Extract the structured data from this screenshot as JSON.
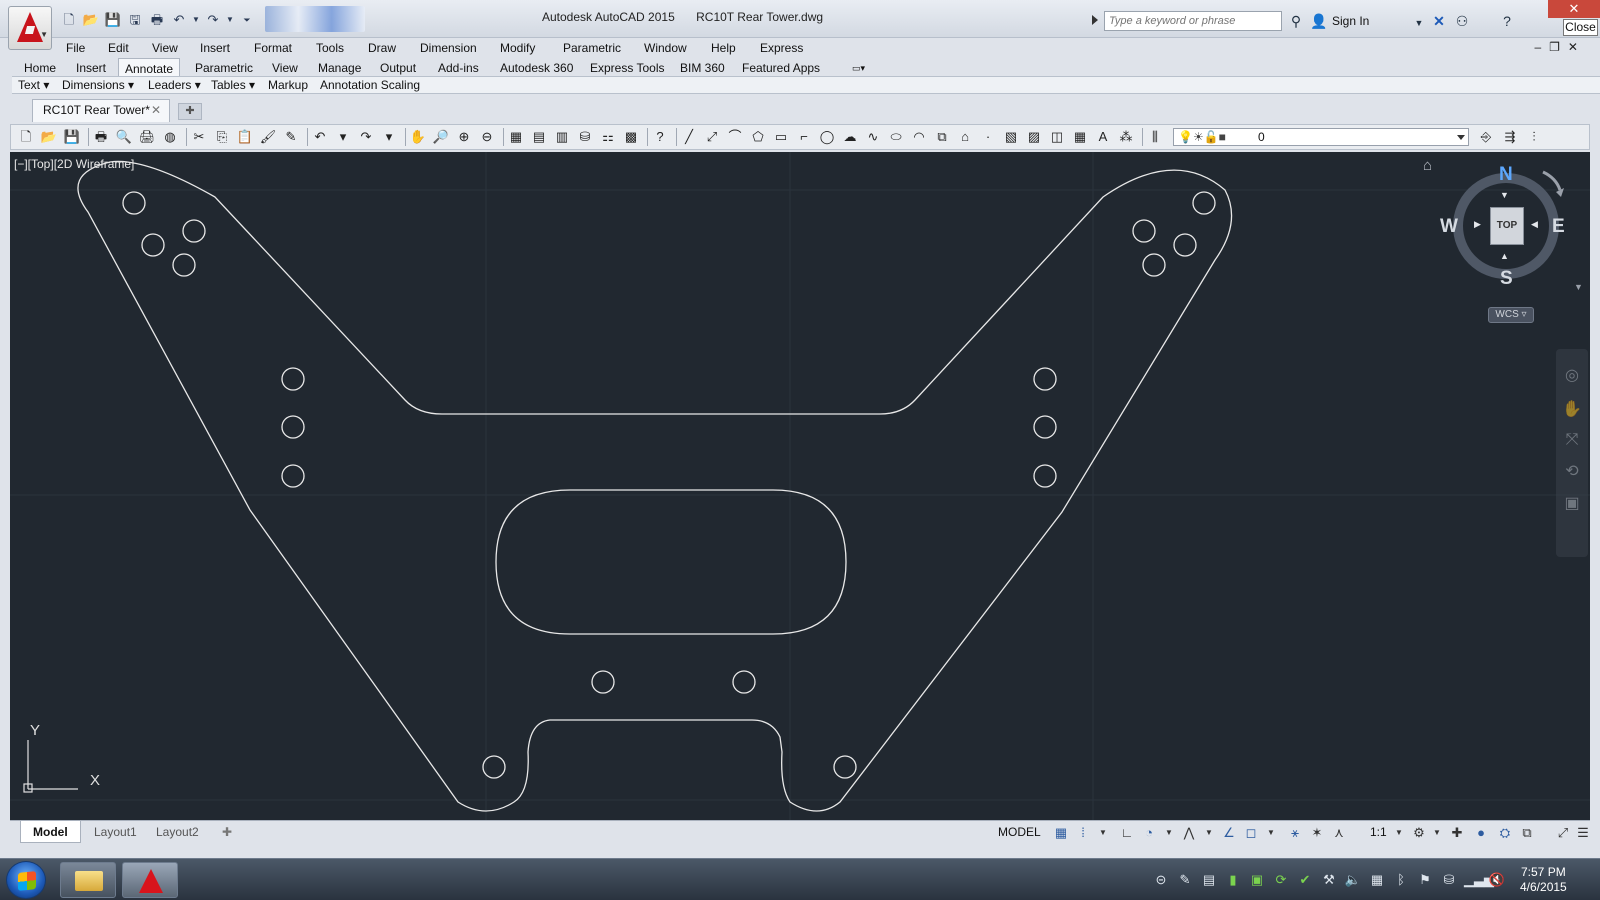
{
  "titlebar": {
    "app_name": "Autodesk AutoCAD 2015",
    "file_name": "RC10T Rear Tower.dwg",
    "search_placeholder": "Type a keyword or phrase",
    "sign_in": "Sign In",
    "close_tooltip": "Close"
  },
  "menu": [
    "File",
    "Edit",
    "View",
    "Insert",
    "Format",
    "Tools",
    "Draw",
    "Dimension",
    "Modify",
    "Parametric",
    "Window",
    "Help",
    "Express"
  ],
  "ribbon_tabs": [
    "Home",
    "Insert",
    "Annotate",
    "Parametric",
    "View",
    "Manage",
    "Output",
    "Add-ins",
    "Autodesk 360",
    "Express Tools",
    "BIM 360",
    "Featured Apps"
  ],
  "ribbon_active_tab": "Annotate",
  "panels": [
    "Text",
    "Dimensions",
    "Leaders",
    "Tables",
    "Markup",
    "Annotation Scaling"
  ],
  "document_tab": "RC10T Rear Tower*",
  "layer_select_value": "0",
  "viewport_label": "[−][Top][2D Wireframe]",
  "viewcube": {
    "top": "TOP",
    "n": "N",
    "s": "S",
    "e": "E",
    "w": "W",
    "wcs": "WCS"
  },
  "ucs": {
    "x": "X",
    "y": "Y"
  },
  "layout_tabs": [
    "Model",
    "Layout1",
    "Layout2"
  ],
  "active_layout": "Model",
  "status": {
    "model": "MODEL",
    "scale": "1:1"
  },
  "clock": {
    "time": "7:57 PM",
    "date": "4/6/2015"
  },
  "colors": {
    "canvas": "#212830",
    "linework": "#e8e8e8",
    "accent_red": "#c8131b"
  }
}
